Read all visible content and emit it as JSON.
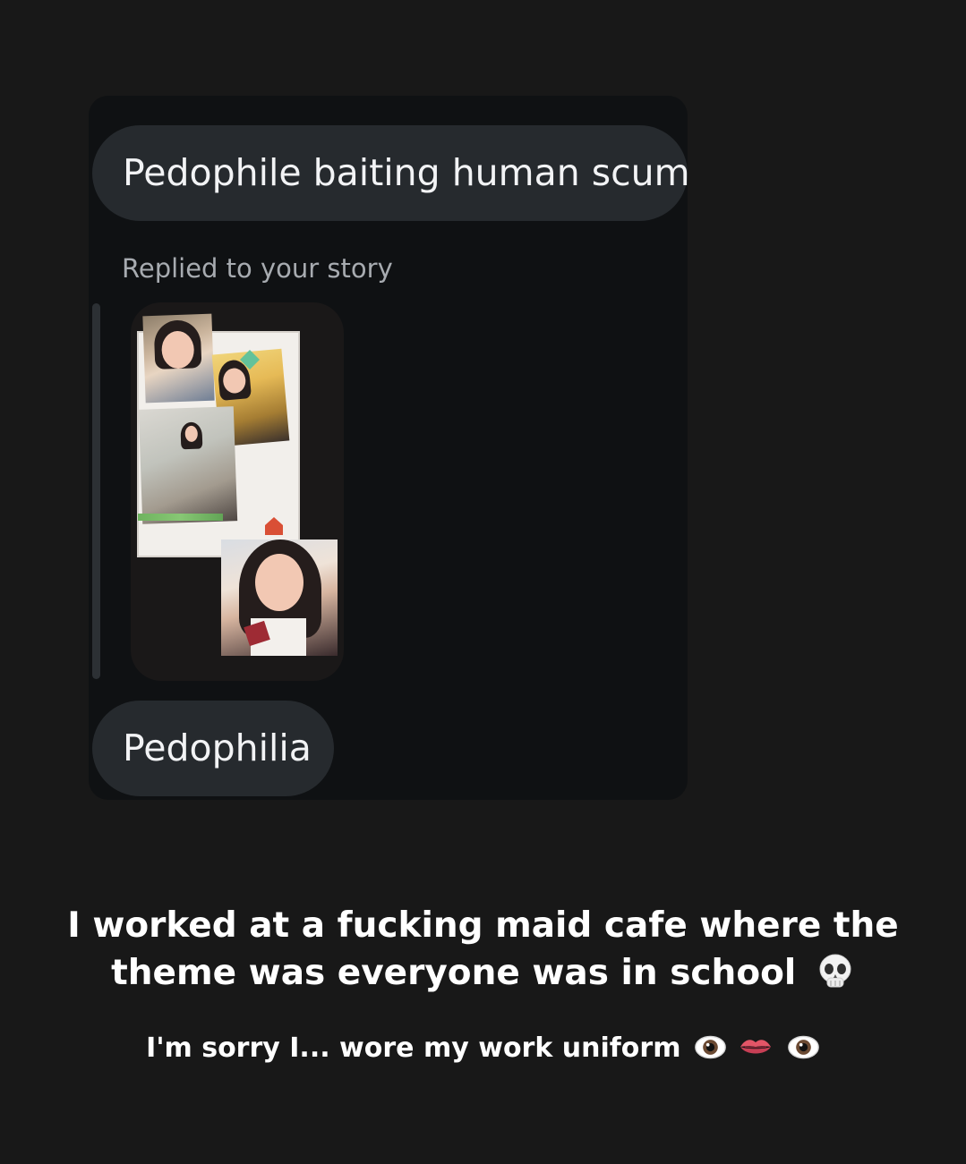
{
  "conversation": {
    "message_1": "Pedophile baiting human scum",
    "reply_meta": "Replied to your story",
    "message_2": "Pedophilia"
  },
  "story_caption": {
    "line_1": "I worked at a fucking maid cafe where the",
    "line_2": "theme was everyone was in school",
    "line_2_emoji": "skull-icon",
    "line_3": "I'm sorry I... wore my work uniform",
    "line_3_emojis": [
      "eye-icon",
      "lips-icon",
      "eye-icon"
    ]
  },
  "colors": {
    "background": "#181818",
    "card": "#0f1113",
    "bubble": "#262a2e",
    "bubble_text": "#f2f3f5",
    "meta_text": "#a7abb0",
    "caption_text": "#ffffff"
  }
}
